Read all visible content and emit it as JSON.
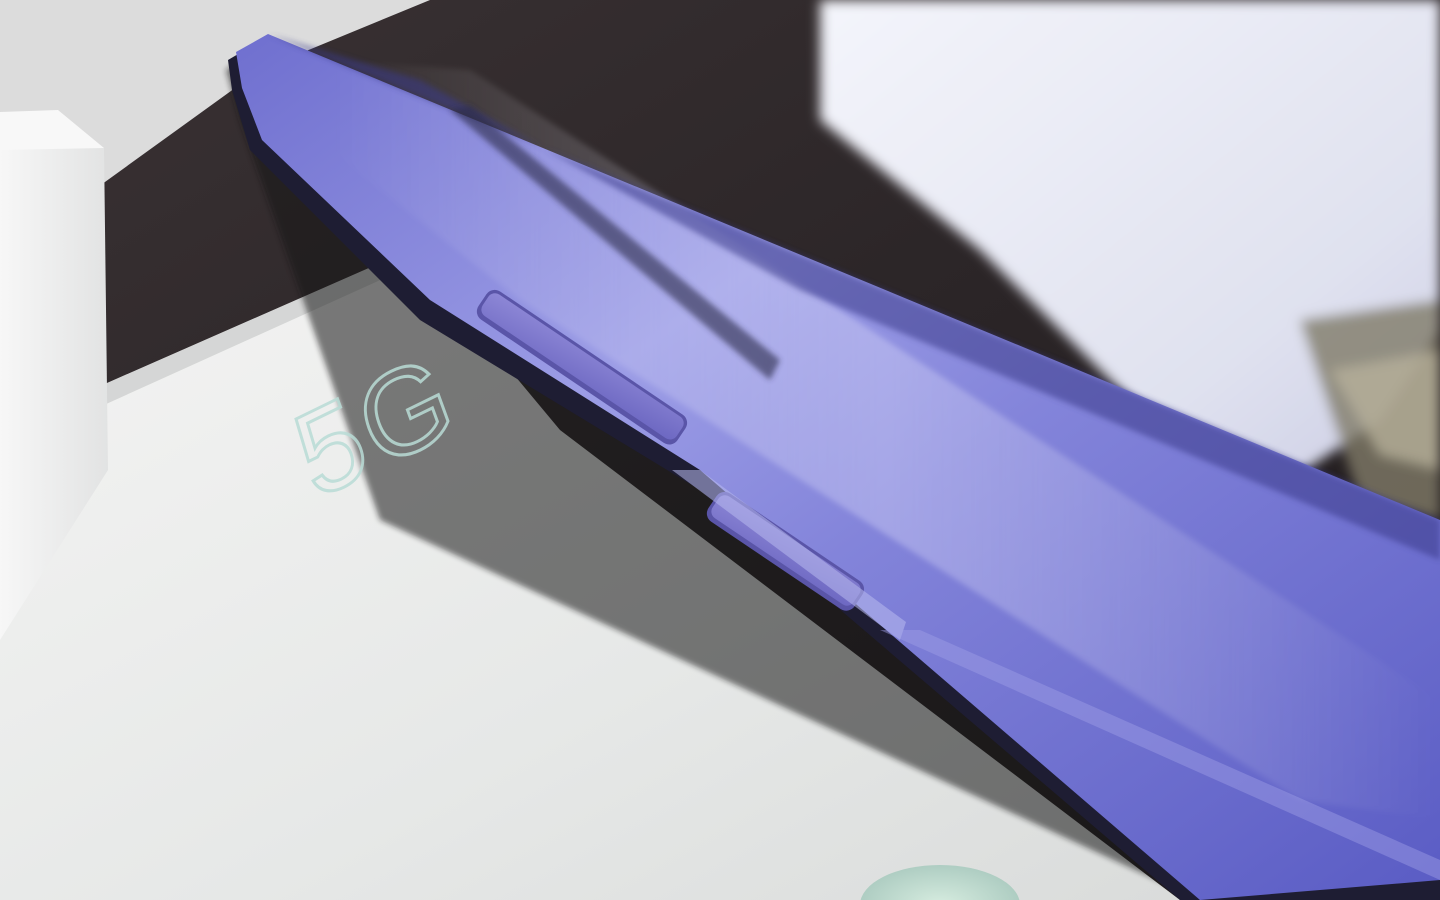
{
  "scene": {
    "box_text": "5G"
  },
  "colors": {
    "desk": "#2a2426",
    "box": "#e9ebea",
    "phone_body": "#7f7fd8",
    "phone_highlight": "#c7c8f2",
    "phone_frame": "#22213a",
    "charger": "#ecedf6",
    "text_holo": "#b9dcd6"
  }
}
